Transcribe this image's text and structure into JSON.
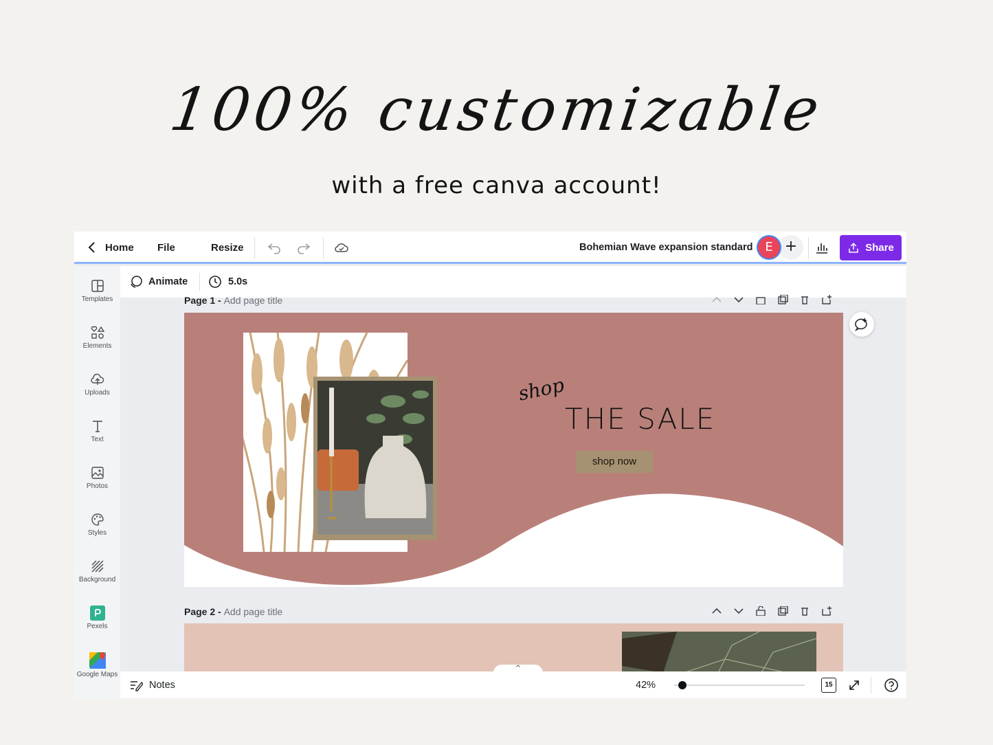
{
  "hero": {
    "title": "100% customizable",
    "subtitle": "with a free canva account!"
  },
  "topbar": {
    "home_label": "Home",
    "file_label": "File",
    "resize_label": "Resize",
    "doc_title": "Bohemian Wave expansion standard",
    "avatar_initial": "E",
    "add_label": "+",
    "share_label": "Share"
  },
  "sidebar": {
    "items": [
      {
        "label": "Templates",
        "icon": "templates-icon"
      },
      {
        "label": "Elements",
        "icon": "elements-icon"
      },
      {
        "label": "Uploads",
        "icon": "upload-icon"
      },
      {
        "label": "Text",
        "icon": "text-icon"
      },
      {
        "label": "Photos",
        "icon": "photos-icon"
      },
      {
        "label": "Styles",
        "icon": "palette-icon"
      },
      {
        "label": "Background",
        "icon": "background-icon"
      },
      {
        "label": "Pexels",
        "icon": "pexels-icon"
      },
      {
        "label": "Google Maps",
        "icon": "google-maps-icon"
      }
    ]
  },
  "toolbar": {
    "animate_label": "Animate",
    "duration": "5.0s"
  },
  "pages": [
    {
      "label": "Page 1 -",
      "title_placeholder": "Add page title"
    },
    {
      "label": "Page 2 -",
      "title_placeholder": "Add page title"
    }
  ],
  "design": {
    "script_word": "shop",
    "headline": "THE SALE",
    "button_label": "shop now",
    "colors": {
      "background": "#b9807a",
      "accent": "#a69272",
      "page2_background": "#e2c3b5"
    }
  },
  "bottombar": {
    "notes_label": "Notes",
    "zoom": "42%",
    "page_count": "15"
  }
}
